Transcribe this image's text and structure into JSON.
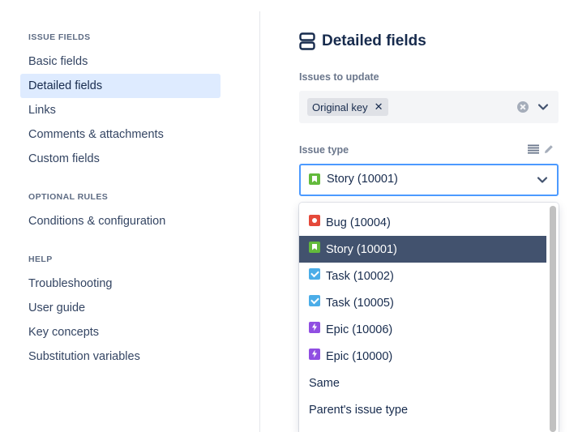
{
  "sidebar": {
    "sections": [
      {
        "title": "ISSUE FIELDS",
        "items": [
          "Basic fields",
          "Detailed fields",
          "Links",
          "Comments & attachments",
          "Custom fields"
        ]
      },
      {
        "title": "OPTIONAL RULES",
        "items": [
          "Conditions & configuration"
        ]
      },
      {
        "title": "HELP",
        "items": [
          "Troubleshooting",
          "User guide",
          "Key concepts",
          "Substitution variables"
        ]
      }
    ],
    "active_item": "Detailed fields"
  },
  "main": {
    "title": "Detailed fields",
    "title_icon": "fields-stack-icon",
    "issues_to_update": {
      "label": "Issues to update",
      "chips": [
        "Original key"
      ]
    },
    "issue_type": {
      "label": "Issue type",
      "value": "Story (10001)",
      "value_icon": "story-icon"
    },
    "dropdown": {
      "options": [
        {
          "label": "Bug (10004)",
          "icon": "bug-icon"
        },
        {
          "label": "Story (10001)",
          "icon": "story-icon",
          "selected": true
        },
        {
          "label": "Task (10002)",
          "icon": "task-icon"
        },
        {
          "label": "Task (10005)",
          "icon": "task-icon"
        },
        {
          "label": "Epic (10006)",
          "icon": "epic-icon"
        },
        {
          "label": "Epic (10000)",
          "icon": "epic-icon"
        },
        {
          "label": "Same",
          "icon": ""
        },
        {
          "label": "Parent's issue type",
          "icon": ""
        }
      ]
    }
  },
  "colors": {
    "accent": "#4c9aff",
    "active_nav_bg": "#deebff",
    "selected_option_bg": "#42526e",
    "bug": "#e5493a",
    "story": "#63ba3c",
    "task": "#4bade8",
    "epic": "#904ee2"
  }
}
